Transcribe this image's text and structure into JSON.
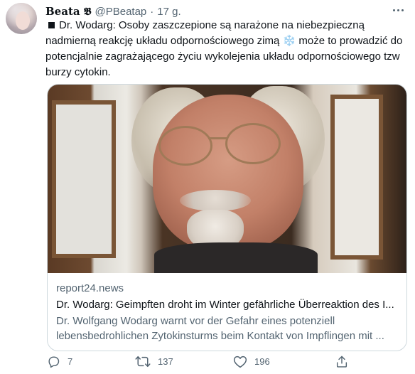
{
  "tweet": {
    "author_name": "Beata 𝕭",
    "handle": "@PBeatap",
    "separator": "·",
    "time": "17 g.",
    "text_prefix": "Dr. Wodarg: Osoby zaszczepione są narażone na niebezpieczną nadmierną reakcję układu odpornościowego zimą ",
    "text_emoji": "❄️",
    "text_suffix": " może to prowadzić do potencjalnie zagrażającego życiu wykolejenia układu odpornościowego tzw burzy cytokin."
  },
  "card": {
    "domain": "report24.news",
    "title": "Dr. Wodarg: Geimpften droht im Winter gefährliche Überreaktion des I...",
    "description": "Dr. Wolfgang Wodarg warnt vor der Gefahr eines potenziell lebensbedrohlichen Zytokinsturms beim Kontakt von Impflingen mit ..."
  },
  "actions": {
    "reply_count": "7",
    "retweet_count": "137",
    "like_count": "196"
  },
  "icons": {
    "reply": "reply-icon",
    "retweet": "retweet-icon",
    "like": "like-icon",
    "share": "share-icon",
    "more": "more-icon"
  },
  "colors": {
    "text": "#0f1419",
    "secondary": "#536471",
    "border": "#cfd9de"
  }
}
